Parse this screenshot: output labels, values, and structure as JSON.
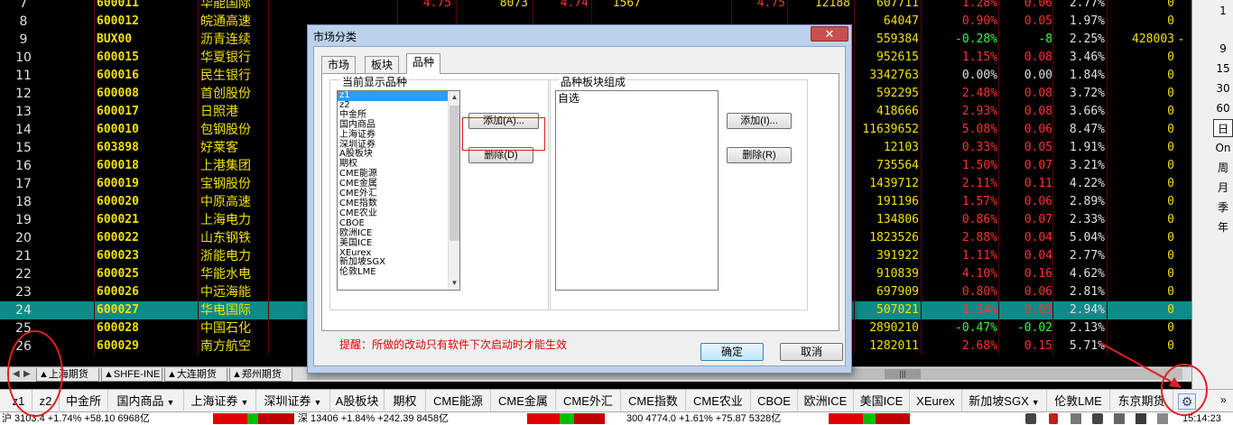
{
  "rows": [
    {
      "idx": "7",
      "code": "600011",
      "name": "华能国际",
      "p1": "4.75",
      "p2": "8073",
      "p3": "4.74",
      "p4": "1567",
      "p5": "4.75",
      "p6": "12188",
      "a": "607711",
      "b": "1.28%",
      "b_color": "red",
      "c": "0.06",
      "c_color": "red",
      "d": "2.77%",
      "e": "0"
    },
    {
      "idx": "8",
      "code": "600012",
      "name": "皖通高速",
      "a": "64047",
      "b": "0.90%",
      "b_color": "red",
      "c": "0.05",
      "c_color": "red",
      "d": "1.97%",
      "e": "0"
    },
    {
      "idx": "9",
      "code": "BUX00",
      "name": "沥青连续",
      "a": "559384",
      "b": "-0.28%",
      "b_color": "green",
      "c": "-8",
      "c_color": "green",
      "d": "2.25%",
      "e": "428003",
      "e2": "-"
    },
    {
      "idx": "10",
      "code": "600015",
      "name": "华夏银行",
      "a": "952615",
      "b": "1.15%",
      "b_color": "red",
      "c": "0.08",
      "c_color": "red",
      "d": "3.46%",
      "e": "0"
    },
    {
      "idx": "11",
      "code": "600016",
      "name": "民生银行",
      "a": "3342763",
      "b": "0.00%",
      "b_color": "white",
      "c": "0.00",
      "c_color": "white",
      "d": "1.84%",
      "e": "0"
    },
    {
      "idx": "12",
      "code": "600008",
      "name": "首创股份",
      "a": "592295",
      "b": "2.48%",
      "b_color": "red",
      "c": "0.08",
      "c_color": "red",
      "d": "3.72%",
      "e": "0"
    },
    {
      "idx": "13",
      "code": "600017",
      "name": "日照港",
      "a": "418666",
      "b": "2.93%",
      "b_color": "red",
      "c": "0.08",
      "c_color": "red",
      "d": "3.66%",
      "e": "0"
    },
    {
      "idx": "14",
      "code": "600010",
      "name": "包钢股份",
      "a": "11639652",
      "b": "5.08%",
      "b_color": "red",
      "c": "0.06",
      "c_color": "red",
      "d": "8.47%",
      "e": "0"
    },
    {
      "idx": "15",
      "code": "603898",
      "name": "好莱客",
      "a": "12103",
      "b": "0.33%",
      "b_color": "red",
      "c": "0.05",
      "c_color": "red",
      "d": "1.91%",
      "e": "0"
    },
    {
      "idx": "16",
      "code": "600018",
      "name": "上港集团",
      "a": "735564",
      "b": "1.50%",
      "b_color": "red",
      "c": "0.07",
      "c_color": "red",
      "d": "3.21%",
      "e": "0"
    },
    {
      "idx": "17",
      "code": "600019",
      "name": "宝钢股份",
      "a": "1439712",
      "b": "2.11%",
      "b_color": "red",
      "c": "0.11",
      "c_color": "red",
      "d": "4.22%",
      "e": "0"
    },
    {
      "idx": "18",
      "code": "600020",
      "name": "中原高速",
      "a": "191196",
      "b": "1.57%",
      "b_color": "red",
      "c": "0.06",
      "c_color": "red",
      "d": "2.89%",
      "e": "0"
    },
    {
      "idx": "19",
      "code": "600021",
      "name": "上海电力",
      "a": "134806",
      "b": "0.86%",
      "b_color": "red",
      "c": "0.07",
      "c_color": "red",
      "d": "2.33%",
      "e": "0"
    },
    {
      "idx": "20",
      "code": "600022",
      "name": "山东钢铁",
      "a": "1823526",
      "b": "2.88%",
      "b_color": "red",
      "c": "0.04",
      "c_color": "red",
      "d": "5.04%",
      "e": "0"
    },
    {
      "idx": "21",
      "code": "600023",
      "name": "浙能电力",
      "a": "391922",
      "b": "1.11%",
      "b_color": "red",
      "c": "0.04",
      "c_color": "red",
      "d": "2.77%",
      "e": "0"
    },
    {
      "idx": "22",
      "code": "600025",
      "name": "华能水电",
      "a": "910839",
      "b": "4.10%",
      "b_color": "red",
      "c": "0.16",
      "c_color": "red",
      "d": "4.62%",
      "e": "0"
    },
    {
      "idx": "23",
      "code": "600026",
      "name": "中远海能",
      "a": "697909",
      "b": "0.80%",
      "b_color": "red",
      "c": "0.06",
      "c_color": "red",
      "d": "2.81%",
      "e": "0"
    },
    {
      "idx": "24",
      "code": "600027",
      "name": "华电国际",
      "a": "507021",
      "b": "1.34%",
      "b_color": "red",
      "c": "0.05",
      "c_color": "red",
      "d": "2.94%",
      "e": "0",
      "selected": true
    },
    {
      "idx": "25",
      "code": "600028",
      "name": "中国石化",
      "a": "2890210",
      "b": "-0.47%",
      "b_color": "green",
      "c": "-0.02",
      "c_color": "green",
      "d": "2.13%",
      "e": "0"
    },
    {
      "idx": "26",
      "code": "600029",
      "name": "南方航空",
      "a": "1282011",
      "b": "2.68%",
      "b_color": "red",
      "c": "0.15",
      "c_color": "red",
      "d": "5.71%",
      "e": "0"
    }
  ],
  "rightbar": [
    "9",
    "15",
    "30",
    "60",
    "日",
    "On",
    "周",
    "月",
    "季",
    "年"
  ],
  "rightbar_top": "1",
  "sheet_tabs": [
    "▲上海期货",
    "▲SHFE-INE",
    "▲大连期货",
    "▲郑州期货"
  ],
  "scroll_grip": "|||",
  "categories": [
    {
      "label": "z1",
      "dd": false
    },
    {
      "label": "z2",
      "dd": false
    },
    {
      "label": "中金所",
      "dd": false
    },
    {
      "label": "国内商品",
      "dd": true
    },
    {
      "label": "上海证券",
      "dd": true
    },
    {
      "label": "深圳证券",
      "dd": true
    },
    {
      "label": "A股板块",
      "dd": false
    },
    {
      "label": "期权",
      "dd": false
    },
    {
      "label": "CME能源",
      "dd": false
    },
    {
      "label": "CME金属",
      "dd": false
    },
    {
      "label": "CME外汇",
      "dd": false
    },
    {
      "label": "CME指数",
      "dd": false
    },
    {
      "label": "CME农业",
      "dd": false
    },
    {
      "label": "CBOE",
      "dd": false
    },
    {
      "label": "欧洲ICE",
      "dd": false
    },
    {
      "label": "美国ICE",
      "dd": false
    },
    {
      "label": "XEurex",
      "dd": false
    },
    {
      "label": "新加坡SGX",
      "dd": true
    },
    {
      "label": "伦敦LME",
      "dd": false
    },
    {
      "label": "东京期货",
      "dd": false
    }
  ],
  "cat_more": "»",
  "status": {
    "sh": "沪 3103.4 +1.74% +58.10 6968亿",
    "sz": "深 13406 +1.84% +242.39 8458亿",
    "other": "300 4774.0 +1.61% +75.87 5328亿",
    "time": "15:14:23"
  },
  "dialog": {
    "title": "市场分类",
    "close": "✕",
    "tabs": [
      "市场",
      "板块",
      "品种"
    ],
    "active_tab": 2,
    "left_group": "当前显示品种",
    "right_group": "品种板块组成",
    "left_items": [
      "z1",
      "z2",
      "中金所",
      "国内商品",
      "上海证券",
      "深圳证券",
      "A股板块",
      "期权",
      "CME能源",
      "CME金属",
      "CME外汇",
      "CME指数",
      "CME农业",
      "CBOE",
      "欧洲ICE",
      "美国ICE",
      "XEurex",
      "新加坡SGX",
      "伦敦LME"
    ],
    "right_items": [
      "自选"
    ],
    "add_left": "添加(A)...",
    "del_left": "删除(D)",
    "add_right": "添加(I)...",
    "del_right": "删除(R)",
    "note": "提醒：所做的改动只有软件下次启动时才能生效",
    "ok": "确定",
    "cancel": "取消"
  }
}
